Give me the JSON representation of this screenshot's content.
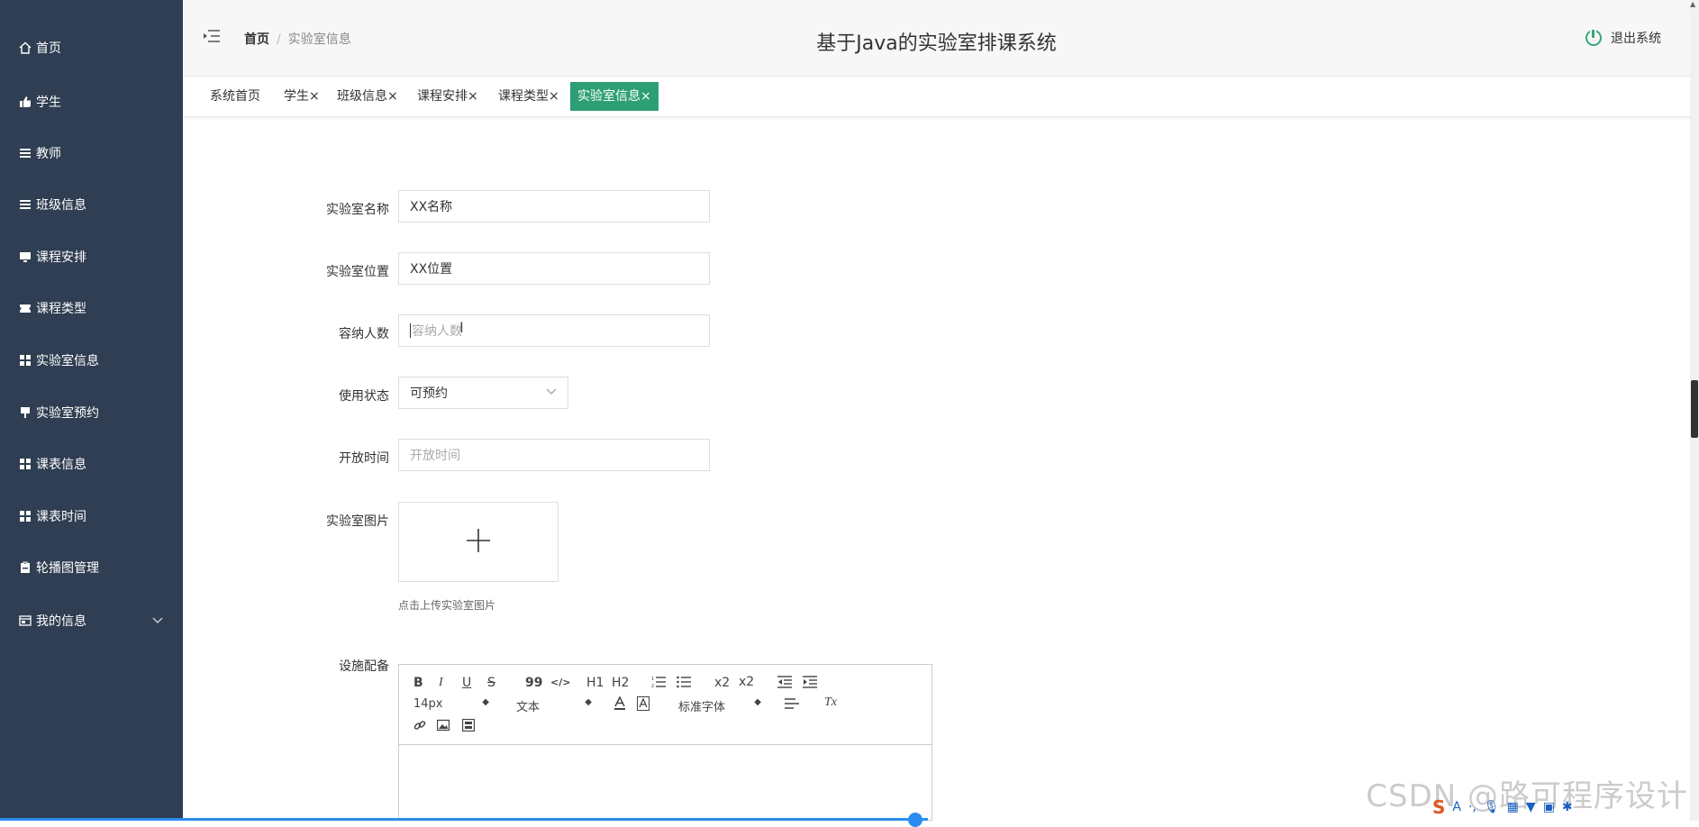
{
  "sidebar": {
    "items": [
      {
        "label": "首页",
        "icon": "home-icon"
      },
      {
        "label": "学生",
        "icon": "thumbs-up-icon"
      },
      {
        "label": "教师",
        "icon": "list-icon"
      },
      {
        "label": "班级信息",
        "icon": "list-icon"
      },
      {
        "label": "课程安排",
        "icon": "monitor-icon"
      },
      {
        "label": "课程类型",
        "icon": "ticket-icon"
      },
      {
        "label": "实验室信息",
        "icon": "grid-icon"
      },
      {
        "label": "实验室预约",
        "icon": "flag-icon"
      },
      {
        "label": "课表信息",
        "icon": "grid-icon"
      },
      {
        "label": "课表时间",
        "icon": "grid-icon"
      },
      {
        "label": "轮播图管理",
        "icon": "clipboard-icon"
      },
      {
        "label": "我的信息",
        "icon": "window-icon"
      }
    ]
  },
  "header": {
    "breadcrumb_home": "首页",
    "breadcrumb_sep": "/",
    "breadcrumb_current": "实验室信息",
    "title": "基于Java的实验室排课系统",
    "logout_label": "退出系统"
  },
  "tabs": [
    {
      "label": "系统首页",
      "closable": false
    },
    {
      "label": "学生",
      "closable": true
    },
    {
      "label": "班级信息",
      "closable": true
    },
    {
      "label": "课程安排",
      "closable": true
    },
    {
      "label": "课程类型",
      "closable": true
    },
    {
      "label": "实验室信息",
      "closable": true,
      "active": true
    }
  ],
  "tab_close_glyph": "×",
  "form": {
    "name_label": "实验室名称",
    "name_value": "XX名称",
    "location_label": "实验室位置",
    "location_value": "XX位置",
    "capacity_label": "容纳人数",
    "capacity_placeholder": "容纳人数",
    "status_label": "使用状态",
    "status_value": "可预约",
    "open_time_label": "开放时间",
    "open_time_placeholder": "开放时间",
    "image_label": "实验室图片",
    "upload_hint": "点击上传实验室图片",
    "facilities_label": "设施配备"
  },
  "editor": {
    "bold": "B",
    "italic": "I",
    "underline": "U",
    "strike": "S",
    "quote": "99",
    "code": "</>",
    "h1": "H1",
    "h2": "H2",
    "subscript": "x2",
    "superscript": "x2",
    "size_value": "14px",
    "header_value": "文本",
    "font_value": "标准字体",
    "clear": "Tx"
  },
  "watermark": "CSDN @路可程序设计",
  "colors": {
    "sidebar_bg": "#2f3e52",
    "active_tab": "#2c9f74",
    "accent_blue": "#2d8cf0"
  }
}
